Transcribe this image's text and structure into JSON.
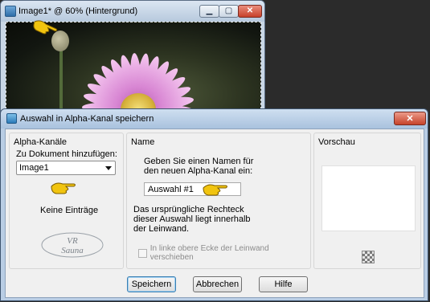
{
  "image_window": {
    "title": "Image1* @  60% (Hintergrund)",
    "controls": {
      "minimize_icon": "minimize-icon",
      "maximize_icon": "maximize-icon",
      "close_icon": "close-icon"
    }
  },
  "dialog": {
    "title": "Auswahl in Alpha-Kanal speichern",
    "close_label": "✕",
    "alpha": {
      "group_label": "Alpha-Kanäle",
      "add_label": "Zu Dokument hinzufügen:",
      "document_selected": "Image1",
      "empty_text": "Keine Einträge"
    },
    "name": {
      "group_label": "Name",
      "prompt": "Geben Sie einen Namen für den neuen Alpha-Kanal ein:",
      "value": "Auswahl #1",
      "info": "Das ursprüngliche Rechteck dieser Auswahl liegt innerhalb der Leinwand.",
      "checkbox_label": "In linke obere Ecke der Leinwand verschieben",
      "checkbox_checked": false
    },
    "preview": {
      "group_label": "Vorschau"
    },
    "buttons": {
      "save": "Speichern",
      "cancel": "Abbrechen",
      "help": "Hilfe"
    },
    "watermark": {
      "line1": "VR",
      "line2": "Sauna"
    }
  },
  "colors": {
    "title_gradient_top": "#cfdff0",
    "title_gradient_bottom": "#a9c2de",
    "close_red": "#c6432b",
    "hand_yellow": "#f1c40f"
  }
}
